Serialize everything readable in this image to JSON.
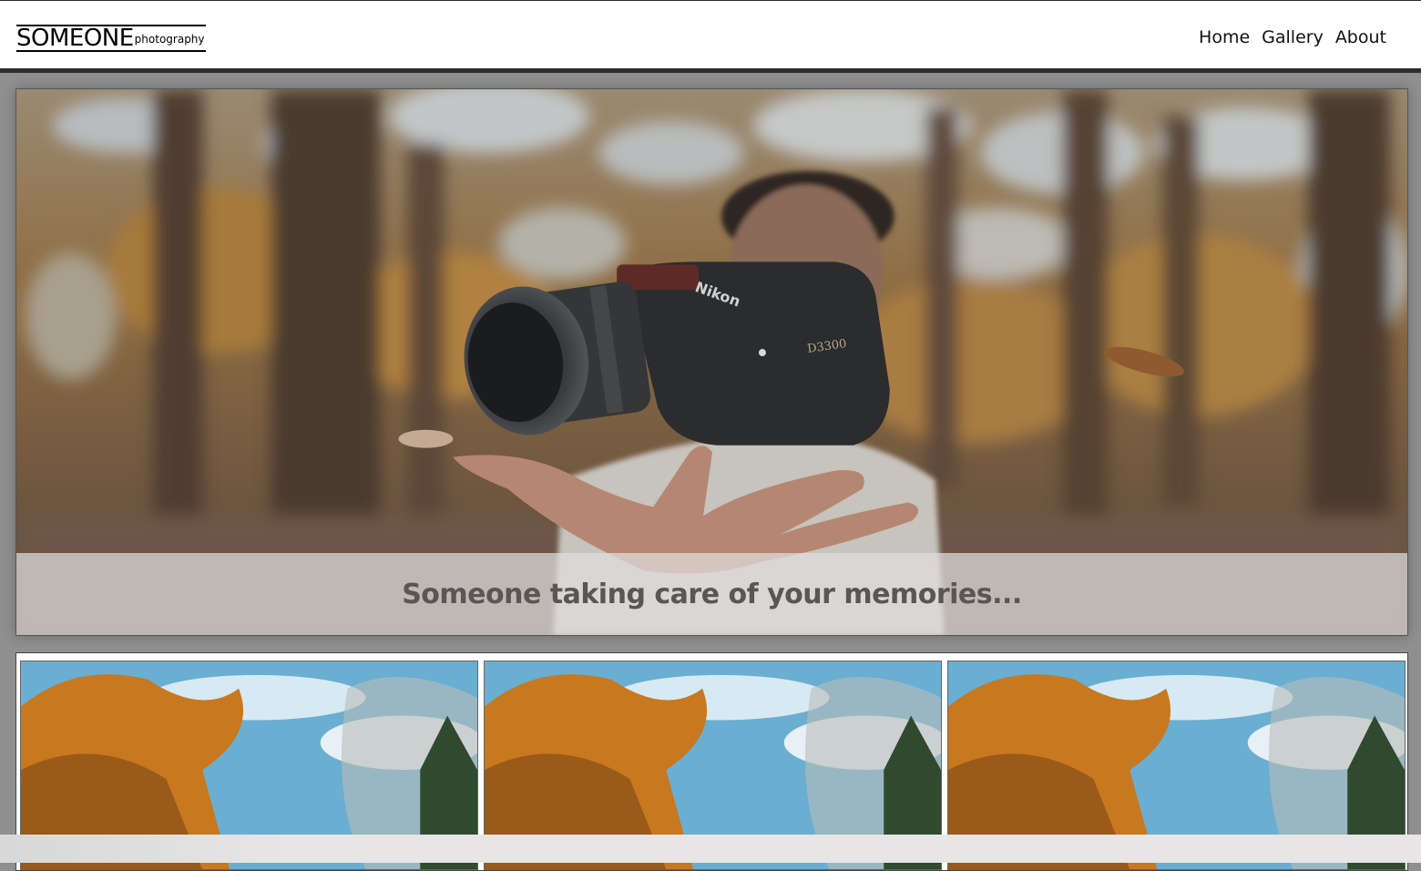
{
  "brand": {
    "name": "SOMEONE",
    "tagline": "photography"
  },
  "nav": {
    "items": [
      {
        "label": "Home"
      },
      {
        "label": "Gallery"
      },
      {
        "label": "About"
      }
    ]
  },
  "hero": {
    "image_subject": "hand tossing a Nikon D3300 camera in an autumn forest",
    "camera_brand": "Nikon",
    "camera_model": "D3300",
    "caption": "Someone taking care of your memories..."
  },
  "gallery": {
    "thumbnails": [
      {
        "subject": "autumn treetops against blue sky"
      },
      {
        "subject": "autumn treetops against blue sky"
      },
      {
        "subject": "autumn treetops against blue sky"
      }
    ]
  },
  "colors": {
    "page_background": "#8f8f8f",
    "navbar_background": "#ffffff",
    "caption_text": "#5a5656",
    "foliage": "#c8781e",
    "sky": "#6aaed2"
  }
}
